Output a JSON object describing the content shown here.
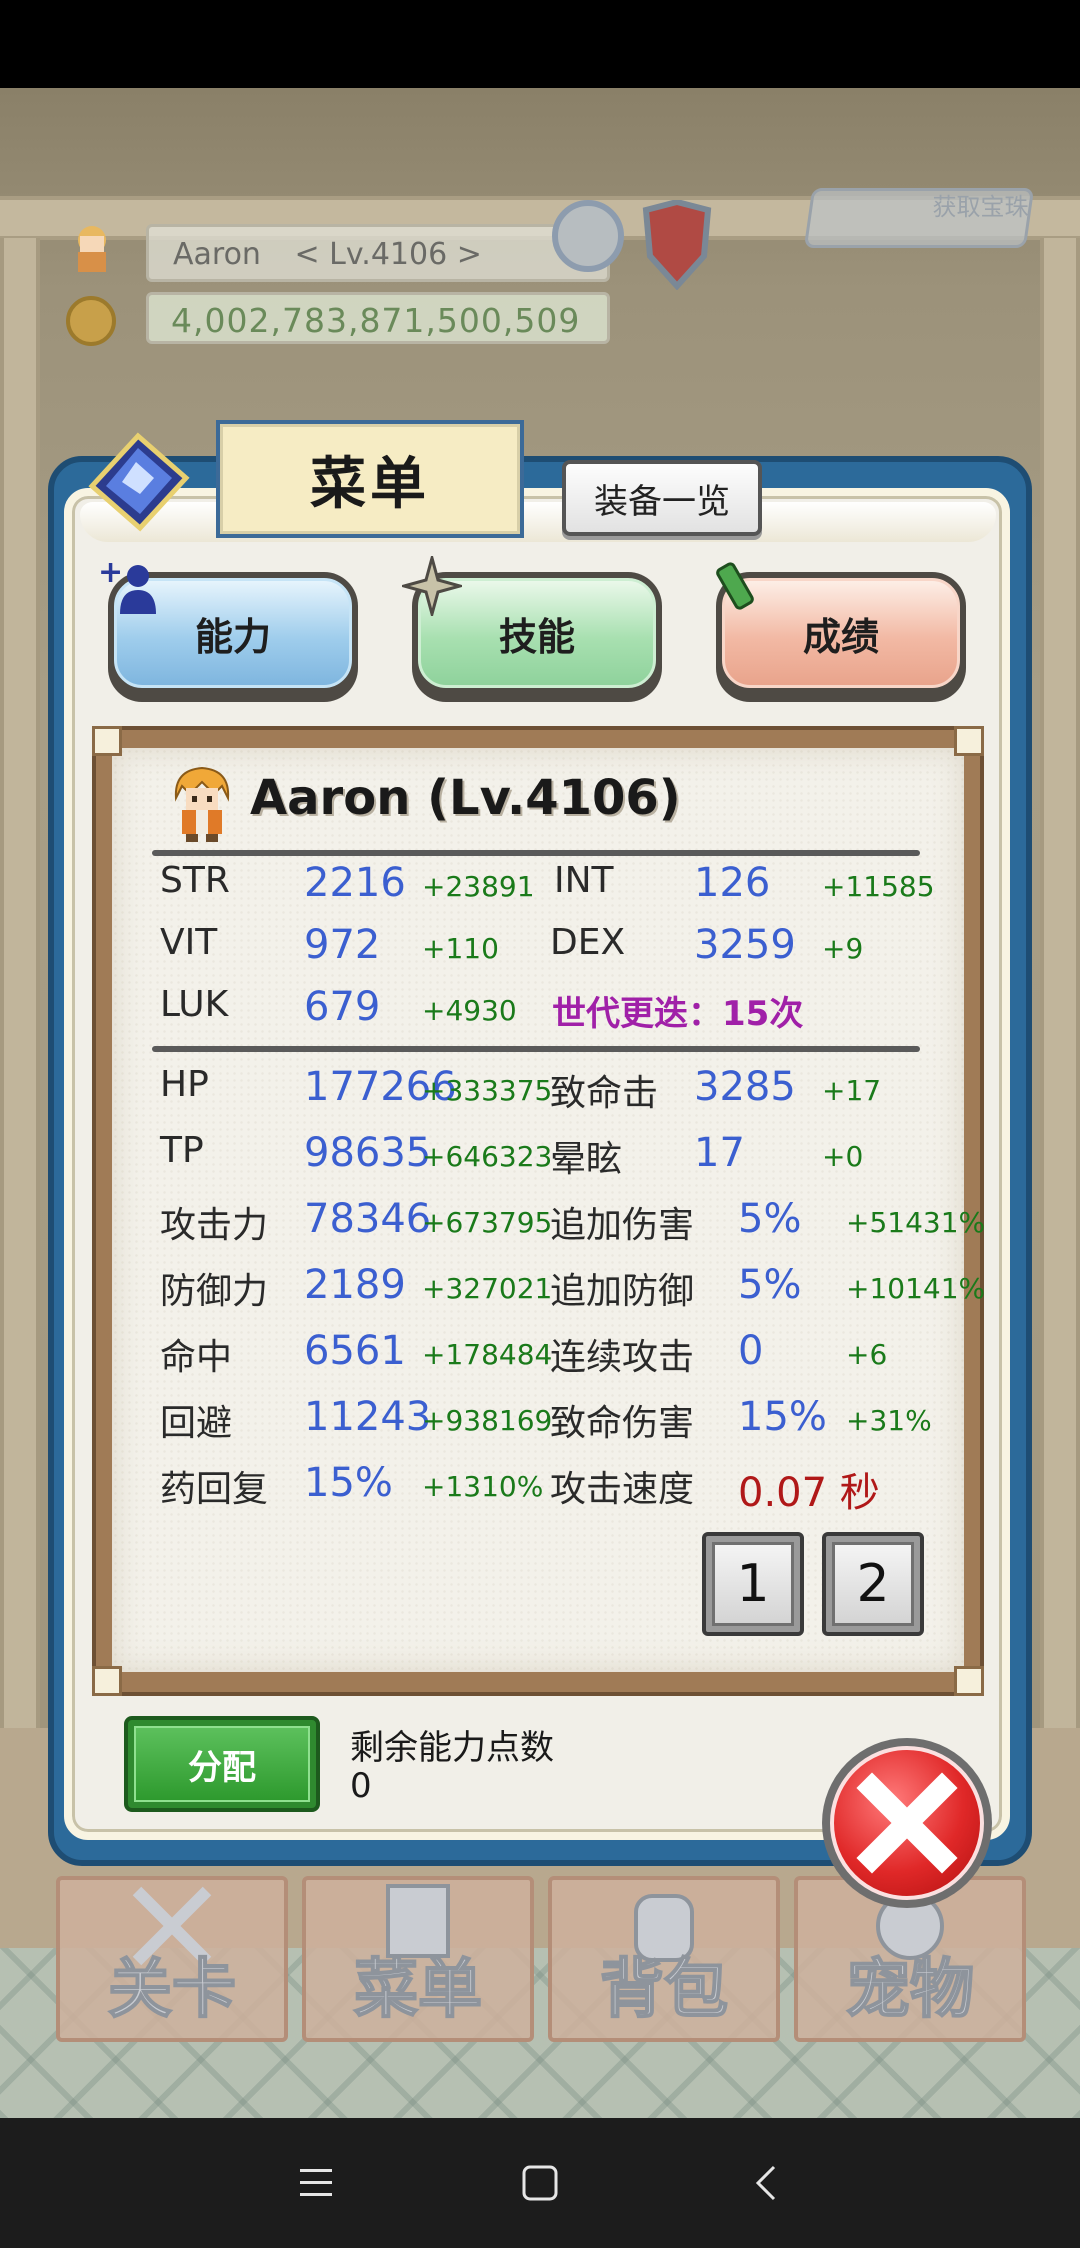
{
  "hud": {
    "player_name": "Aaron",
    "player_level": "< Lv.4106 >",
    "gold": "4,002,783,871,500,509",
    "rewards_label": "获取宝珠"
  },
  "modal": {
    "title": "菜单",
    "equip_list_label": "装备一览",
    "categories": [
      {
        "label": "能力"
      },
      {
        "label": "技能"
      },
      {
        "label": "成绩"
      }
    ]
  },
  "character": {
    "name_line": "Aaron (Lv.4106)"
  },
  "attributes": [
    {
      "label": "STR",
      "value": "2216",
      "bonus": "+23891"
    },
    {
      "label": "INT",
      "value": "126",
      "bonus": "+11585"
    },
    {
      "label": "VIT",
      "value": "972",
      "bonus": "+110"
    },
    {
      "label": "DEX",
      "value": "3259",
      "bonus": "+9"
    },
    {
      "label": "LUK",
      "value": "679",
      "bonus": "+4930"
    }
  ],
  "generation": "世代更迭：15次",
  "combat_stats": [
    {
      "label": "HP",
      "value": "177266",
      "bonus": "+333375"
    },
    {
      "label": "致命击",
      "value": "3285",
      "bonus": "+17"
    },
    {
      "label": "TP",
      "value": "98635",
      "bonus": "+646323"
    },
    {
      "label": "晕眩",
      "value": "17",
      "bonus": "+0"
    },
    {
      "label": "攻击力",
      "value": "78346",
      "bonus": "+673795"
    },
    {
      "label": "追加伤害",
      "value": "5%",
      "bonus": "+51431%"
    },
    {
      "label": "防御力",
      "value": "2189",
      "bonus": "+327021"
    },
    {
      "label": "追加防御",
      "value": "5%",
      "bonus": "+10141%"
    },
    {
      "label": "命中",
      "value": "6561",
      "bonus": "+178484"
    },
    {
      "label": "连续攻击",
      "value": "0",
      "bonus": "+6"
    },
    {
      "label": "回避",
      "value": "11243",
      "bonus": "+938169"
    },
    {
      "label": "致命伤害",
      "value": "15%",
      "bonus": "+31%"
    },
    {
      "label": "药回复",
      "value": "15%",
      "bonus": "+1310%"
    },
    {
      "label": "攻击速度",
      "value": "0.07 秒"
    }
  ],
  "pages": [
    "1",
    "2"
  ],
  "assign": {
    "button_label": "分配",
    "remaining_label": "剩余能力点数",
    "remaining_value": "0"
  },
  "bottom_nav": [
    {
      "label": "关卡",
      "icon": "crossed-swords-icon"
    },
    {
      "label": "菜单",
      "icon": "book-icon"
    },
    {
      "label": "背包",
      "icon": "backpack-icon"
    },
    {
      "label": "宠物",
      "icon": "pet-icon"
    }
  ],
  "colors": {
    "stat_value": "#3b5fd0",
    "stat_bonus": "#1a7a1a",
    "generation": "#a020a8",
    "attack_speed": "#b01818",
    "modal_border": "#2c6a9a"
  }
}
